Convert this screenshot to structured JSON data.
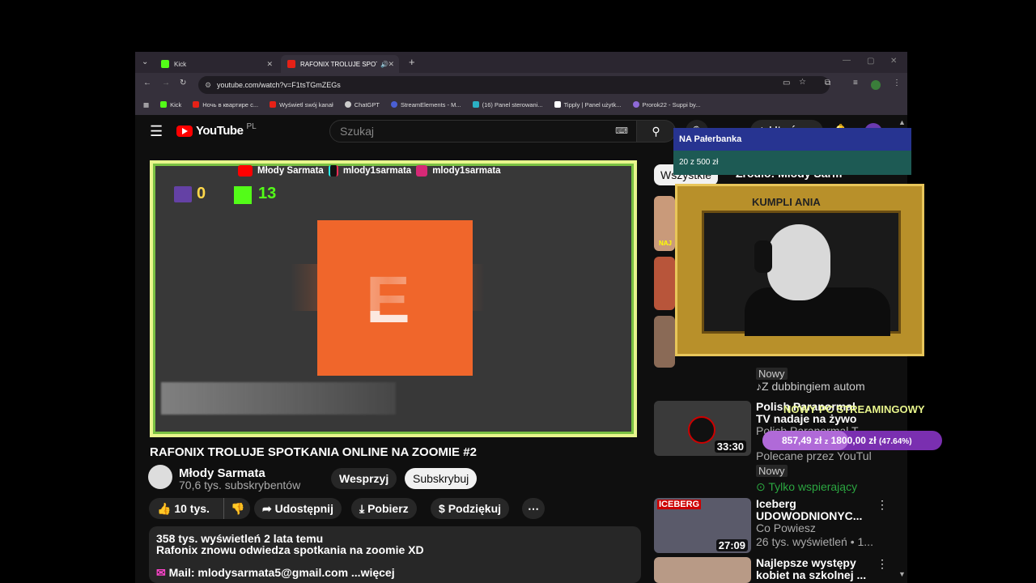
{
  "browser": {
    "tabs": [
      {
        "label": "Kick"
      },
      {
        "label": "RAFONIX TROLUJE SPOTKA"
      }
    ],
    "url": "youtube.com/watch?v=F1tsTGmZEGs",
    "bookmarks": [
      "Kick",
      "Ночь в квартире с...",
      "Wyświetl swój kanał",
      "ChatGPT",
      "StreamElements - M...",
      "(16) Panel sterowani...",
      "Tipply | Panel użytk...",
      "Prorok22 - Suppi by..."
    ]
  },
  "youtube": {
    "logo_text": "YouTube",
    "country": "PL",
    "search_placeholder": "Szukaj",
    "create_label": "Utwórz",
    "video_title": "RAFONIX TROLUJE SPOTKANIA ONLINE NA ZOOMIE #2",
    "channel_name": "Młody Sarmata",
    "subscribers": "70,6 tys. subskrybentów",
    "support_label": "Wesprzyj",
    "subscribe_label": "Subskrybuj",
    "likes": "10 tys.",
    "share_label": "Udostępnij",
    "download_label": "Pobierz",
    "thanks_label": "Podziękuj",
    "desc_stats": "358 tys. wyświetleń  2 lata temu",
    "desc_text": "Rafonix znowu odwiedza spotkania na zoomie XD",
    "desc_mail": "Mail: mlodysarmata5@gmail.com",
    "desc_more": "...więcej",
    "chip_all": "Wszystkie",
    "chip_source": "Źródło: Młody Sarm",
    "player": {
      "social_name1": "Młody Sarmata",
      "social_name2": "mlody1sarmata",
      "social_name3": "mlody1sarmata",
      "twitch_count": "0",
      "kick_count": "13"
    },
    "sidebar": [
      {
        "title": "",
        "meta1": "Nowy",
        "meta2": "Z dubbingiem autom"
      },
      {
        "title": "Polish Paranormal",
        "title2": "TV nadaje na żywo",
        "meta1": "Polish Paranormal T",
        "meta2": "Polecane przez YouTul",
        "meta3": "Nowy",
        "meta4": "Tylko wspierający",
        "duration": "33:30"
      },
      {
        "title": "Iceberg",
        "title2": "UDOWODNIONYC...",
        "meta1": "Co Powiesz",
        "meta2": "26 tys. wyświetleń • 1...",
        "duration": "27:09"
      },
      {
        "title": "Najlepsze występy",
        "title2": "kobiet na szkolnej ..."
      }
    ]
  },
  "overlays": {
    "donation_name": "NA Pałerbanka",
    "donation_goal": "20 z 500 zł",
    "thumb_text": "NAJ",
    "streaming_label": "NOWY PC STREAMINGOWY",
    "goal_current": "857,49 zł",
    "goal_sep": "z",
    "goal_total": "1800,00 zł",
    "goal_percent": "(47.64%)",
    "goal_fraction": 0.4764,
    "frame_top_text": "KUMPLI ANIA"
  }
}
